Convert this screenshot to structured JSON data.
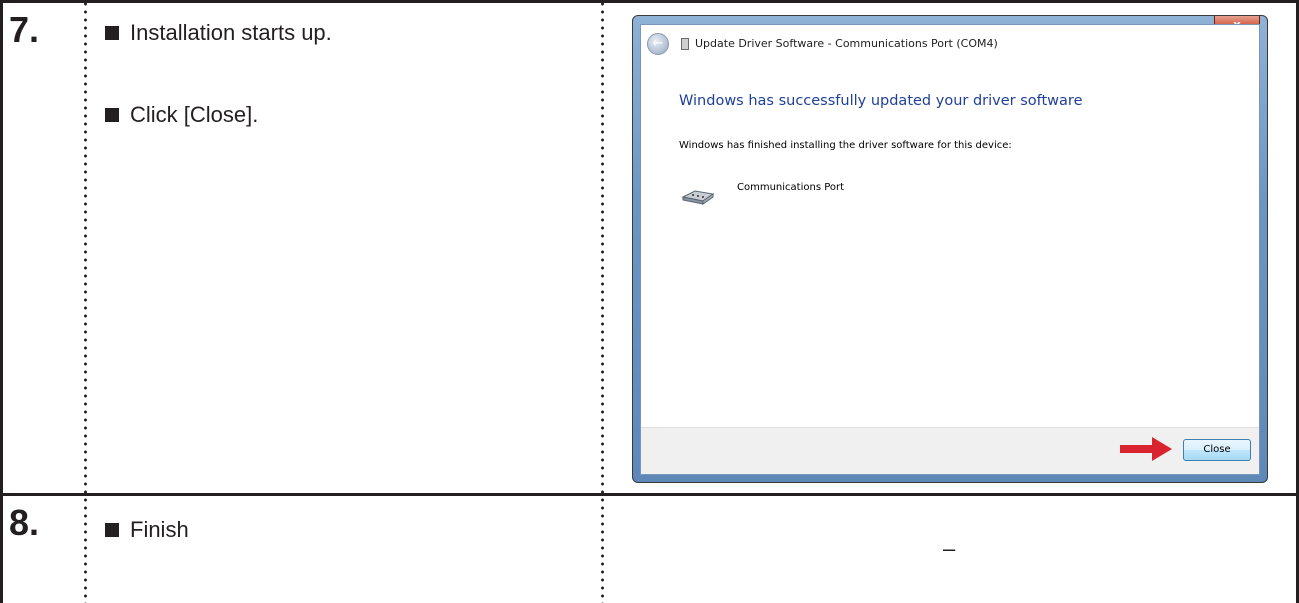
{
  "steps": [
    {
      "number": "7.",
      "bullets": [
        "Installation starts up.",
        "Click [Close]."
      ]
    },
    {
      "number": "8.",
      "bullets": [
        "Finish"
      ],
      "right_text": "–"
    }
  ],
  "dialog": {
    "close_glyph": "x",
    "back_glyph": "←",
    "title": "Update Driver Software - Communications Port (COM4)",
    "headline": "Windows has successfully updated your driver software",
    "message": "Windows has finished installing the driver software for this device:",
    "device_name": "Communications Port",
    "close_button_label": "Close",
    "colors": {
      "headline": "#1f3f99",
      "arrow": "#d9232e",
      "close_button_border": "#3c7fb1"
    }
  },
  "icons": [
    "back-arrow-icon",
    "window-icon",
    "serial-port-icon",
    "red-arrow-icon",
    "close-icon"
  ]
}
